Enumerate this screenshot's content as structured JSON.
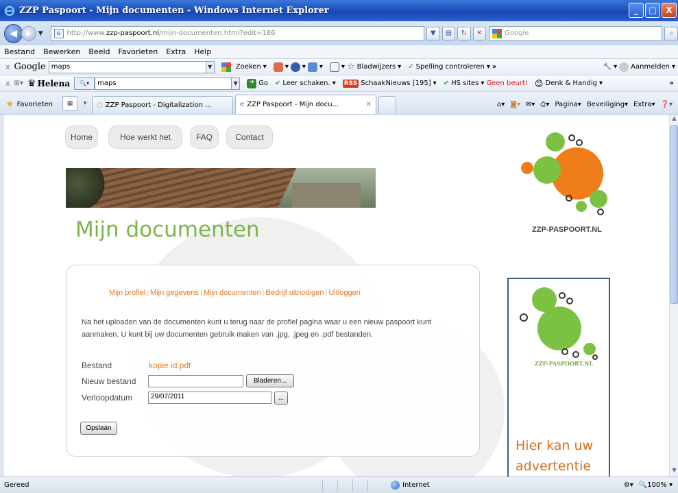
{
  "window": {
    "title": "ZZP Paspoort - Mijn documenten - Windows Internet Explorer",
    "buttons": {
      "minimize": "_",
      "maximize": "□",
      "close": "X"
    }
  },
  "address": {
    "url_prefix": "http://www.",
    "url_domain": "zzp-paspoort.nl",
    "url_rest": "/mijn-documenten.html?edit=186",
    "search_placeholder": "Google"
  },
  "menu": [
    "Bestand",
    "Bewerken",
    "Beeld",
    "Favorieten",
    "Extra",
    "Help"
  ],
  "google_toolbar": {
    "logo": "Google",
    "query": "maps",
    "search": "Zoeken",
    "bookmarks": "Bladwijzers",
    "spelling": "Spelling controleren",
    "more": "»",
    "signin": "Aanmelden"
  },
  "helena_toolbar": {
    "name": "Helena",
    "query": "maps",
    "go": "Go",
    "chess": "Leer schaken.",
    "rss": "RSS",
    "news": "SchaakNieuws [195]",
    "hs": "HS sites",
    "beurt": "Geen beurt!",
    "denk": "Denk & Handig",
    "more": "»"
  },
  "favbar": {
    "favorites": "Favorieten",
    "tabs": [
      {
        "label": "ZZP Paspoort - Digitalization ..."
      },
      {
        "label": "ZZP Paspoort - Mijn docu...",
        "close": "✕"
      }
    ],
    "cmd": {
      "page": "Pagina",
      "safety": "Beveiliging",
      "extra": "Extra"
    }
  },
  "site": {
    "nav": [
      "Home",
      "Hoe werkt het",
      "FAQ",
      "Contact"
    ],
    "page_title": "Mijn documenten",
    "logo_text": "ZZP-PASPOORT.NL",
    "subnav": [
      "Mijn profiel",
      "Mijn gegevens",
      "Mijn documenten",
      "Bedrijf uitnodigen",
      "Uitloggen"
    ],
    "intro_line1": "Na het uploaden van de documenten kunt u terug naar de profiel pagina waar u een nieuw paspoort kunt",
    "intro_line2": "aanmaken. U kunt bij uw documenten gebruik maken van .jpg, .jpeg en .pdf bestanden.",
    "form": {
      "file_label": "Bestand",
      "file_value": "kopie id.pdf",
      "new_file_label": "Nieuw bestand",
      "new_file_value": "",
      "browse": "Bladeren...",
      "expiry_label": "Verloopdatum",
      "expiry_value": "29/07/2011",
      "date_picker": "...",
      "save": "Opslaan"
    },
    "ad": {
      "logo_text": "ZZP-PASPOORT.NL",
      "text": "Hier kan uw advertentie"
    }
  },
  "status": {
    "left": "Gereed",
    "zone": "Internet",
    "zoom": "100%"
  },
  "colors": {
    "accent_green": "#7ab648",
    "accent_orange": "#e07a1e",
    "logo_orange": "#ef7d1a",
    "logo_green": "#7cc242"
  }
}
